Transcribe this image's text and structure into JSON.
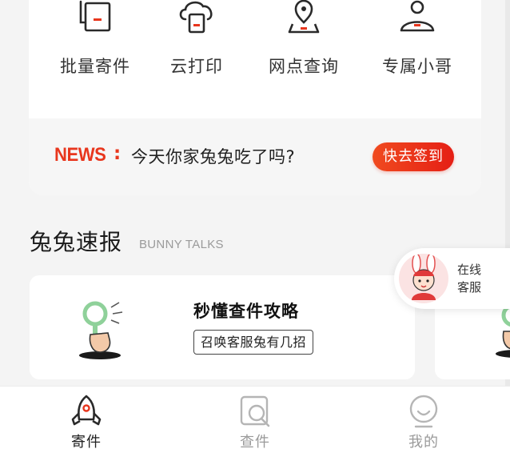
{
  "quick_actions": [
    {
      "label": "批量寄件",
      "icon": "batch-send-icon"
    },
    {
      "label": "云打印",
      "icon": "cloud-print-icon"
    },
    {
      "label": "网点查询",
      "icon": "location-pin-icon"
    },
    {
      "label": "专属小哥",
      "icon": "courier-person-icon"
    }
  ],
  "news": {
    "tag": "NEWS",
    "colon": ":",
    "text": "今天你家兔兔吃了吗?",
    "button": "快去签到"
  },
  "section": {
    "title": "兔兔速报",
    "subtitle": "BUNNY TALKS"
  },
  "article_card": {
    "title": "秒懂查件攻略",
    "tag": "召唤客服兔有几招",
    "illustration": "magnifier-hand-icon"
  },
  "customer_service": {
    "line1": "在线",
    "line2": "客服",
    "avatar": "bunny-mascot-avatar"
  },
  "tabs": [
    {
      "label": "寄件",
      "icon": "rocket-icon",
      "active": true
    },
    {
      "label": "查件",
      "icon": "search-package-icon",
      "active": false
    },
    {
      "label": "我的",
      "icon": "smiley-face-icon",
      "active": false
    }
  ],
  "colors": {
    "accent": "#e8361d",
    "text": "#333333",
    "inactive": "#9a9a9a",
    "background": "#f4f4f4"
  }
}
